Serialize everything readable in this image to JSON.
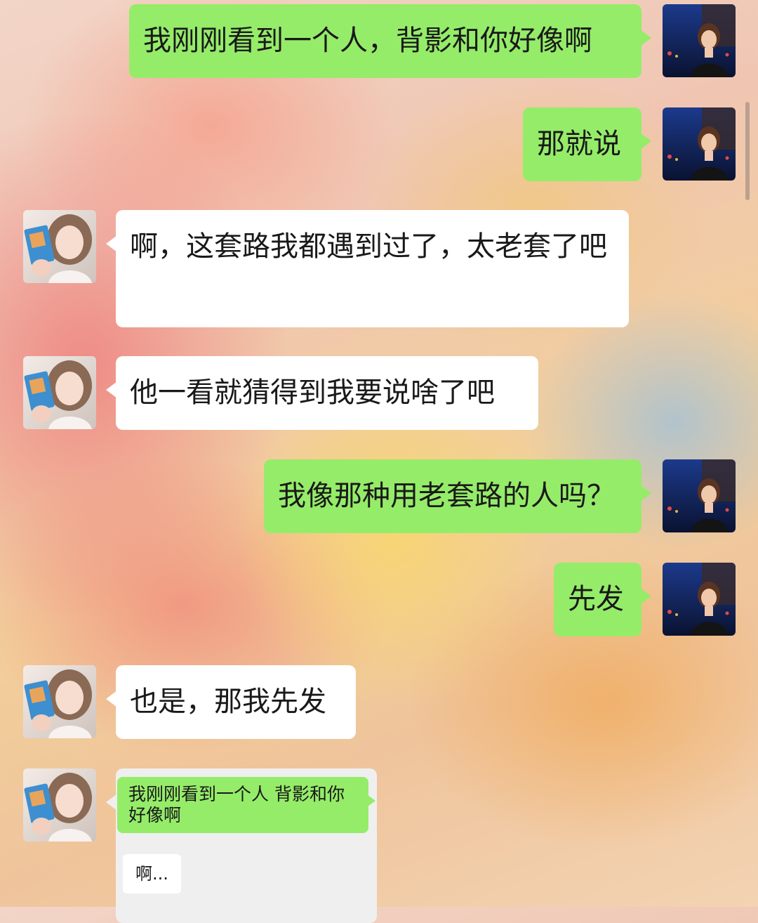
{
  "messages": [
    {
      "from": "me",
      "text": "我刚刚看到一个人，背影和你好像啊"
    },
    {
      "from": "me",
      "text": "那就说"
    },
    {
      "from": "them",
      "text": "啊，这套路我都遇到过了，太老套了吧"
    },
    {
      "from": "them",
      "text": "他一看就猜得到我要说啥了吧"
    },
    {
      "from": "me",
      "text": "我像那种用老套路的人吗？"
    },
    {
      "from": "me",
      "text": "先发"
    },
    {
      "from": "them",
      "text": "也是，那我先发"
    },
    {
      "from": "them",
      "type": "forwarded-chat",
      "quoted_green": "我刚刚看到一个人 背影和你好像啊",
      "quoted_white": "啊..."
    }
  ],
  "colors": {
    "my_bubble": "#95ec69",
    "their_bubble": "#ffffff",
    "text": "#191919"
  },
  "icons": {
    "my_avatar": "my-avatar-photo",
    "their_avatar": "their-avatar-photo"
  }
}
